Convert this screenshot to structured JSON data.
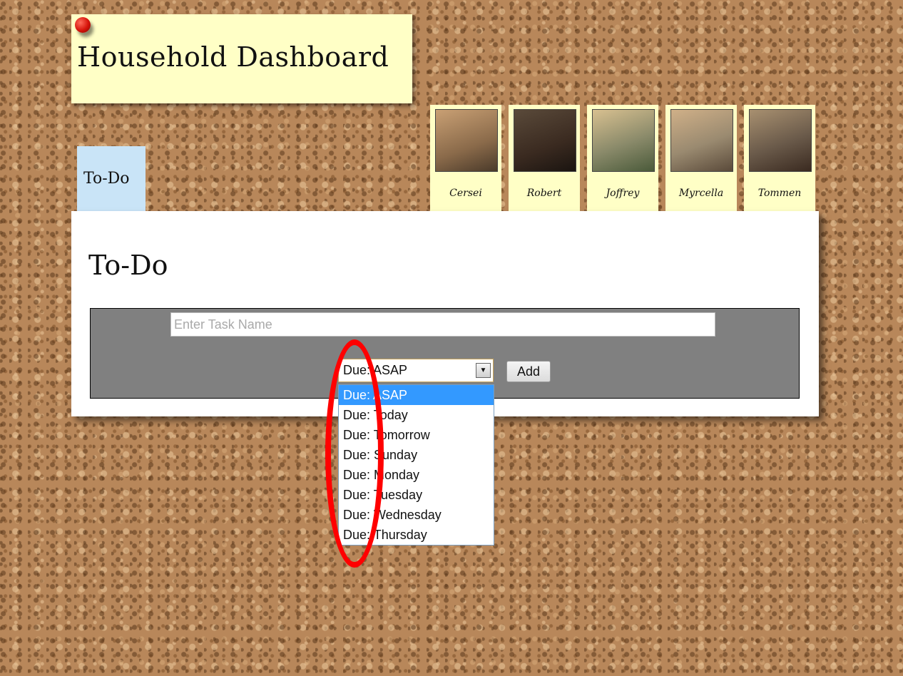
{
  "header": {
    "title": "Household Dashboard"
  },
  "tabs": [
    {
      "label": "To-Do"
    }
  ],
  "members": [
    {
      "name": "Cersei",
      "photo_bg": "#8a6a4a"
    },
    {
      "name": "Robert",
      "photo_bg": "#3a2a20"
    },
    {
      "name": "Joffrey",
      "photo_bg": "#6a7a5a"
    },
    {
      "name": "Myrcella",
      "photo_bg": "#7a6a5a"
    },
    {
      "name": "Tommen",
      "photo_bg": "#5a4a3a"
    }
  ],
  "main": {
    "title": "To-Do",
    "task_input": {
      "placeholder": "Enter Task Name",
      "value": ""
    },
    "due_select": {
      "selected": "Due: ASAP",
      "options": [
        "Due: ASAP",
        "Due: Today",
        "Due: Tomorrow",
        "Due: Sunday",
        "Due: Monday",
        "Due: Tuesday",
        "Due: Wednesday",
        "Due: Thursday"
      ]
    },
    "add_button": "Add"
  },
  "colors": {
    "note_yellow": "#ffffc6",
    "tab_blue": "#c9e4f7",
    "form_gray": "#808080",
    "highlight_blue": "#3399ff",
    "annotation_red": "#ff0000"
  }
}
